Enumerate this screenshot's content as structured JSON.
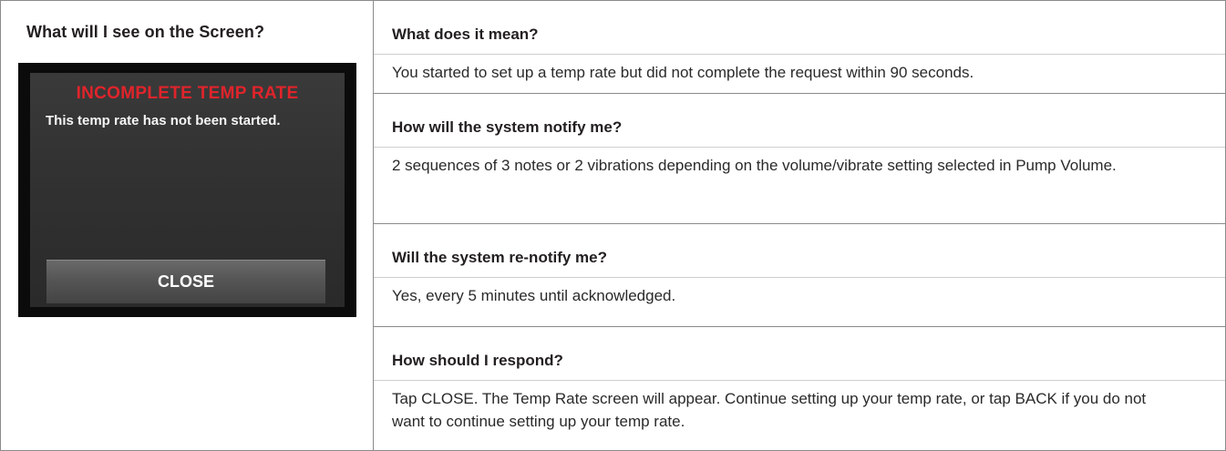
{
  "left": {
    "title": "What will I see on the Screen?",
    "device": {
      "alarm_title": "INCOMPLETE TEMP RATE",
      "message": "This temp rate has not been started.",
      "close_label": "CLOSE"
    }
  },
  "sections": [
    {
      "heading": "What does it mean?",
      "body": "You started to set up a temp rate but did not complete the request within 90 seconds."
    },
    {
      "heading": "How will the system notify me?",
      "body": "2 sequences of 3 notes or 2 vibrations depending on the volume/vibrate setting selected in Pump Volume."
    },
    {
      "heading": "Will the system re-notify me?",
      "body": "Yes, every 5 minutes until acknowledged."
    },
    {
      "heading": "How should I respond?",
      "body": "Tap CLOSE. The Temp Rate screen will appear. Continue setting up your temp rate, or tap BACK if you do not want to continue setting up your temp rate."
    }
  ]
}
